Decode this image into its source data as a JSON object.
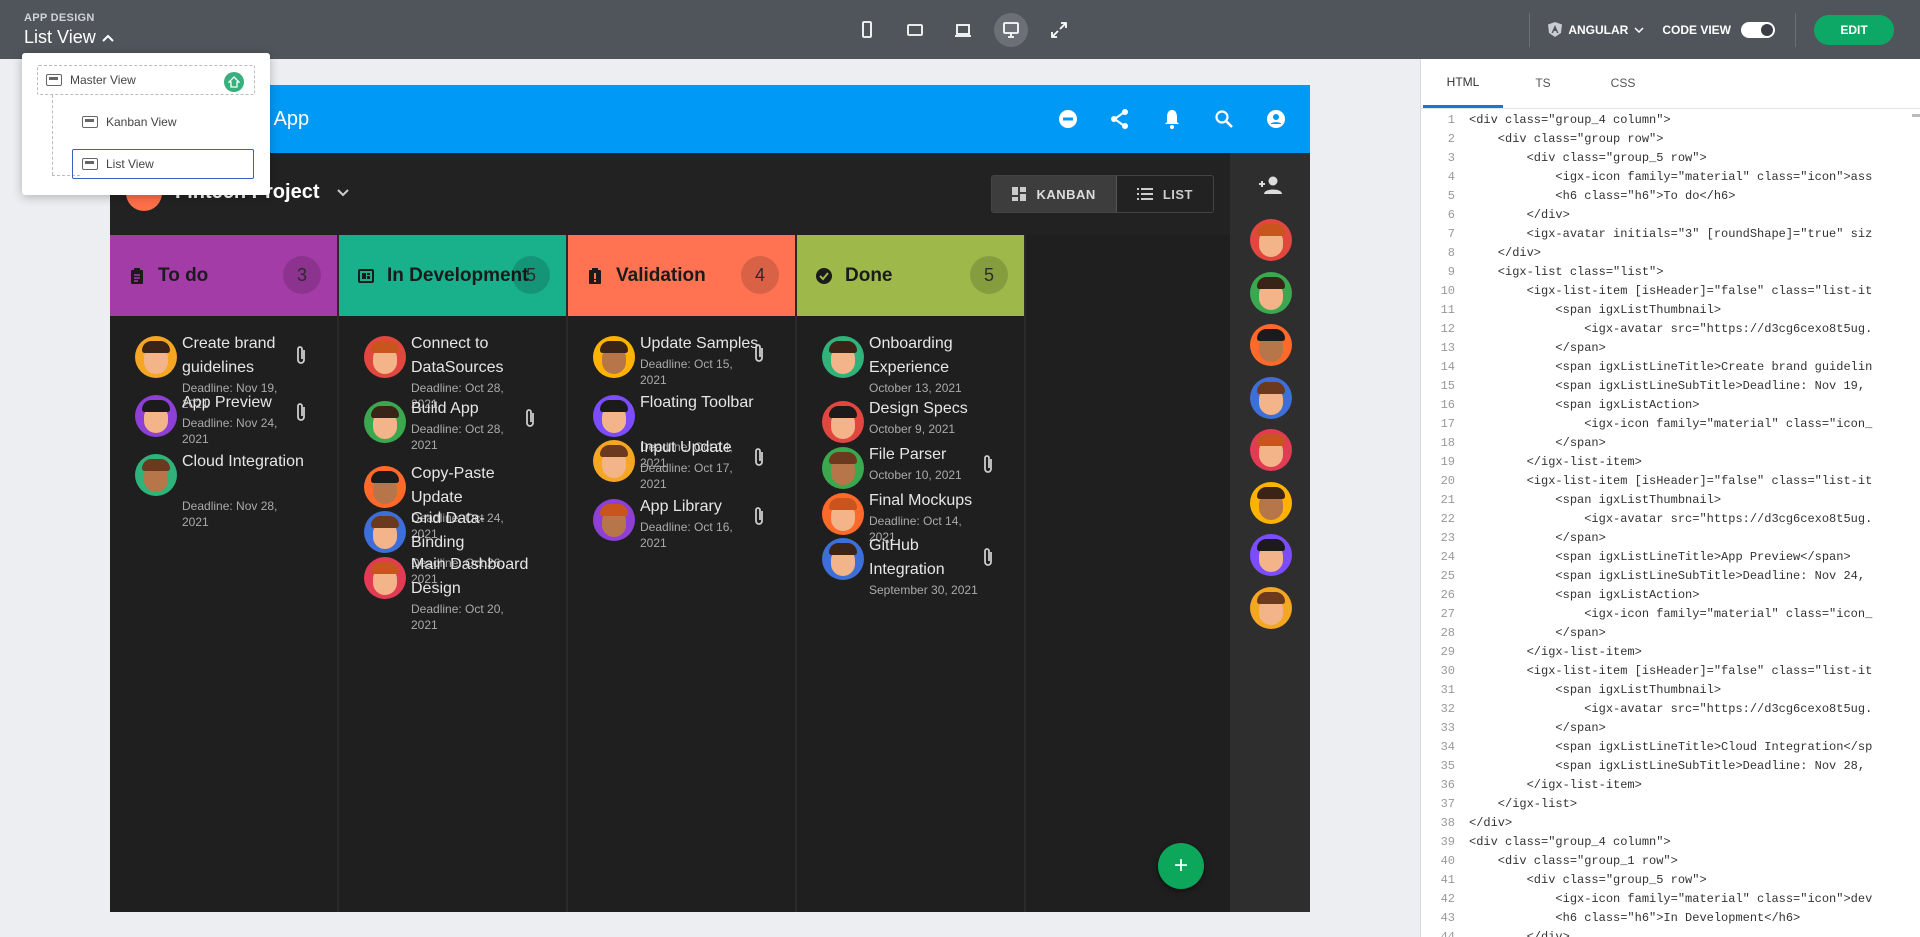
{
  "topbar": {
    "section_label": "APP DESIGN",
    "current_view": "List View",
    "framework": "ANGULAR",
    "code_view_label": "CODE VIEW",
    "code_view_on": true,
    "edit_label": "EDIT"
  },
  "view_menu": {
    "items": [
      {
        "label": "Master View",
        "home": true
      },
      {
        "label": "Kanban View"
      },
      {
        "label": "List View",
        "selected": true
      }
    ]
  },
  "app": {
    "title": "Fintech App",
    "title_visible": "n App",
    "project_title": "Fintech Project",
    "segments": [
      {
        "label": "KANBAN",
        "active": true
      },
      {
        "label": "LIST",
        "active": false
      }
    ],
    "fab_label": "+",
    "columns": [
      {
        "name": "To do",
        "count": "3",
        "color": "#a43ca8",
        "icon": "clipboard-icon",
        "items": [
          {
            "title": "Create brand guidelines",
            "sub": "Deadline: Nov 19, 2021",
            "clip": true
          },
          {
            "title": "App Preview",
            "sub": "Deadline: Nov 24, 2021",
            "clip": true
          },
          {
            "title": "Cloud Integration",
            "sub": "Deadline: Nov 28, 2021",
            "clip": false
          }
        ]
      },
      {
        "name": "In Development",
        "count": "5",
        "color": "#19b08c",
        "icon": "developer-board-icon",
        "items": [
          {
            "title": "Connect to DataSources",
            "sub": "Deadline: Oct 28, 2021",
            "clip": false
          },
          {
            "title": "Build App",
            "sub": "Deadline: Oct 28, 2021",
            "clip": true
          },
          {
            "title": "Copy-Paste Update",
            "sub": "Deadline: Oct 24, 2021",
            "clip": false
          },
          {
            "title": "Grid Data-Binding",
            "sub": "Deadline: Oct 26, 2021",
            "clip": false
          },
          {
            "title": "Main Dashboard Design",
            "sub": "Deadline: Oct 20, 2021",
            "clip": false
          }
        ]
      },
      {
        "name": "Validation",
        "count": "4",
        "color": "#ff7352",
        "icon": "assignment-late-icon",
        "items": [
          {
            "title": "Update Samples",
            "sub": "Deadline: Oct 15, 2021",
            "clip": true
          },
          {
            "title": "Floating Toolbar",
            "sub": "Deadline: Oct 14, 2021",
            "clip": false
          },
          {
            "title": "Input Update",
            "sub": "Deadline: Oct 17, 2021",
            "clip": true
          },
          {
            "title": "App Library",
            "sub": "Deadline: Oct 16, 2021",
            "clip": true
          }
        ]
      },
      {
        "name": "Done",
        "count": "5",
        "color": "#9eb94a",
        "icon": "check-circle-icon",
        "items": [
          {
            "title": "Onboarding Experience",
            "sub": "October 13, 2021",
            "clip": false
          },
          {
            "title": "Design Specs",
            "sub": "October 9, 2021",
            "clip": false
          },
          {
            "title": "File Parser",
            "sub": "October 10, 2021",
            "clip": true
          },
          {
            "title": "Final Mockups",
            "sub": "Deadline: Oct 14, 2021",
            "clip": false
          },
          {
            "title": "GitHub Integration",
            "sub": "September 30, 2021",
            "clip": true
          }
        ]
      }
    ]
  },
  "code_panel": {
    "tabs": [
      "HTML",
      "TS",
      "CSS"
    ],
    "active_tab": "HTML",
    "lines": [
      "<div class=\"group_4 column\">",
      "    <div class=\"group row\">",
      "        <div class=\"group_5 row\">",
      "            <igx-icon family=\"material\" class=\"icon\">ass",
      "            <h6 class=\"h6\">To do</h6>",
      "        </div>",
      "        <igx-avatar initials=\"3\" [roundShape]=\"true\" siz",
      "    </div>",
      "    <igx-list class=\"list\">",
      "        <igx-list-item [isHeader]=\"false\" class=\"list-it",
      "            <span igxListThumbnail>",
      "                <igx-avatar src=\"https://d3cg6cexo8t5ug.",
      "            </span>",
      "            <span igxListLineTitle>Create brand guidelin",
      "            <span igxListLineSubTitle>Deadline: Nov 19,",
      "            <span igxListAction>",
      "                <igx-icon family=\"material\" class=\"icon_",
      "            </span>",
      "        </igx-list-item>",
      "        <igx-list-item [isHeader]=\"false\" class=\"list-it",
      "            <span igxListThumbnail>",
      "                <igx-avatar src=\"https://d3cg6cexo8t5ug.",
      "            </span>",
      "            <span igxListLineTitle>App Preview</span>",
      "            <span igxListLineSubTitle>Deadline: Nov 24,",
      "            <span igxListAction>",
      "                <igx-icon family=\"material\" class=\"icon_",
      "            </span>",
      "        </igx-list-item>",
      "        <igx-list-item [isHeader]=\"false\" class=\"list-it",
      "            <span igxListThumbnail>",
      "                <igx-avatar src=\"https://d3cg6cexo8t5ug.",
      "            </span>",
      "            <span igxListLineTitle>Cloud Integration</sp",
      "            <span igxListLineSubTitle>Deadline: Nov 28,",
      "        </igx-list-item>",
      "    </igx-list>",
      "</div>",
      "<div class=\"group_4 column\">",
      "    <div class=\"group_1 row\">",
      "        <div class=\"group_5 row\">",
      "            <igx-icon family=\"material\" class=\"icon\">dev",
      "            <h6 class=\"h6\">In Development</h6>",
      "        </div>"
    ]
  },
  "avatar_colors": [
    "#f5a623",
    "#8e3fd6",
    "#2fb37a",
    "#e2473f",
    "#39a84e",
    "#ff6a2b",
    "#3d6fd8",
    "#e23b54",
    "#ffb300",
    "#7c4dff"
  ]
}
